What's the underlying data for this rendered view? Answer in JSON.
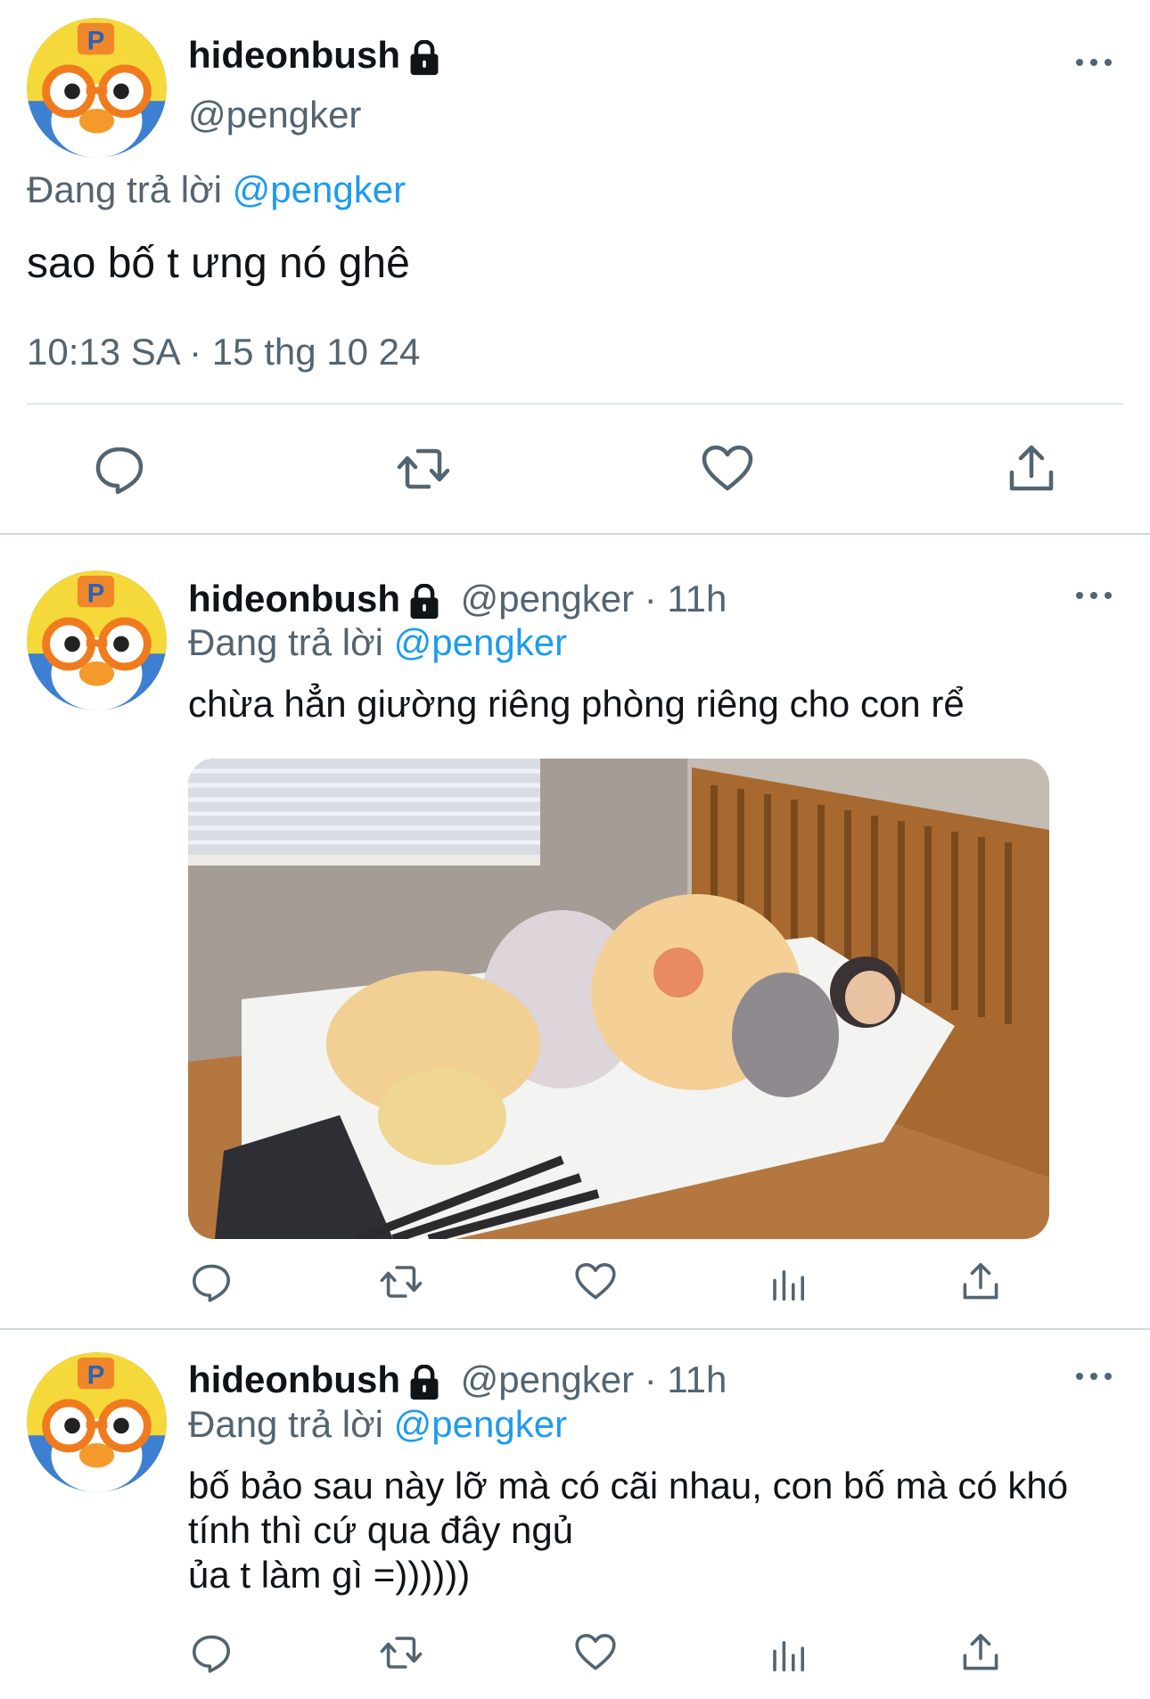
{
  "main_tweet": {
    "display_name": "hideonbush",
    "handle": "@pengker",
    "replying_prefix": "Đang trả lời",
    "replying_to": "@pengker",
    "text": "sao bố t ưng nó ghê",
    "timestamp": "10:13 SA · 15 thg 10 24",
    "icons": [
      "comment-icon",
      "retweet-icon",
      "like-icon",
      "share-icon"
    ]
  },
  "replies": [
    {
      "display_name": "hideonbush",
      "handle": "@pengker",
      "time": "· 11h",
      "replying_prefix": "Đang trả lời",
      "replying_to": "@pengker",
      "text": "chừa hẳn giường riêng phòng riêng cho con rể",
      "has_photo": true,
      "icons": [
        "comment-icon",
        "retweet-icon",
        "like-icon",
        "analytics-icon",
        "share-icon"
      ]
    },
    {
      "display_name": "hideonbush",
      "handle": "@pengker",
      "time": "· 11h",
      "replying_prefix": "Đang trả lời",
      "replying_to": "@pengker",
      "text_lines": [
        "bố bảo sau này lỡ mà có cãi nhau, con bố mà có khó",
        "tính thì cứ qua đây ngủ",
        "ủa t làm gì =))))))"
      ],
      "icons": [
        "comment-icon",
        "retweet-icon",
        "like-icon",
        "analytics-icon",
        "share-icon"
      ]
    }
  ],
  "colors": {
    "text": "#0f1419",
    "secondary": "#536471",
    "link": "#1d9bf0",
    "divider": "#cfd9de"
  }
}
